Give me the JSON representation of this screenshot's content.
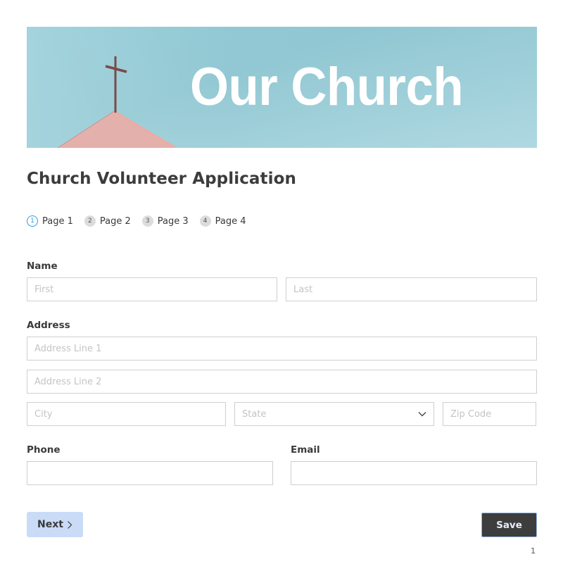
{
  "banner": {
    "title": "Our Church",
    "image_description": "church roof with cross against blue sky",
    "colors": {
      "sky": "#92c8d3",
      "roof": "#e7b1ad",
      "cross": "#7a4a47"
    }
  },
  "form": {
    "title": "Church Volunteer Application",
    "steps": [
      {
        "number": "1",
        "label": "Page 1",
        "active": true
      },
      {
        "number": "2",
        "label": "Page 2",
        "active": false
      },
      {
        "number": "3",
        "label": "Page 3",
        "active": false
      },
      {
        "number": "4",
        "label": "Page 4",
        "active": false
      }
    ],
    "fields": {
      "name": {
        "label": "Name",
        "first_placeholder": "First",
        "last_placeholder": "Last",
        "first_value": "",
        "last_value": ""
      },
      "address": {
        "label": "Address",
        "line1_placeholder": "Address Line 1",
        "line2_placeholder": "Address Line 2",
        "city_placeholder": "City",
        "state_placeholder": "State",
        "zip_placeholder": "Zip Code"
      },
      "phone": {
        "label": "Phone",
        "value": ""
      },
      "email": {
        "label": "Email",
        "value": ""
      }
    },
    "buttons": {
      "next_label": "Next",
      "save_label": "Save"
    },
    "page_number": "1"
  },
  "colors": {
    "accent": "#2e9fd8",
    "next_bg": "#c9dbf7",
    "save_bg": "#3d3d3d"
  }
}
